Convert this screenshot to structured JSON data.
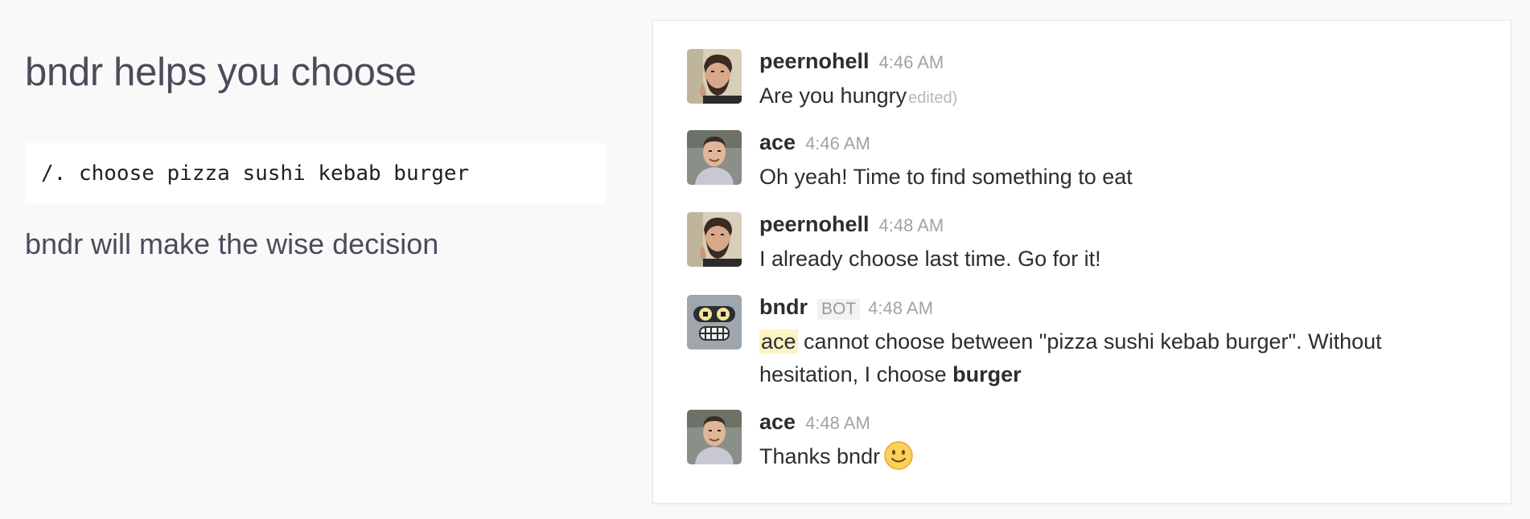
{
  "left": {
    "heading": "bndr helps you choose",
    "command": "/. choose pizza sushi kebab burger",
    "tagline": "bndr will make the wise decision"
  },
  "chat": {
    "messages": [
      {
        "author": "peernohell",
        "time": "4:46 AM",
        "text": "Are you  hungry",
        "edited": "edited)",
        "avatar": "user-avatar-bearded-man"
      },
      {
        "author": "ace",
        "time": "4:46 AM",
        "text": "Oh yeah! Time to find something to eat",
        "avatar": "user-avatar-smiling-man"
      },
      {
        "author": "peernohell",
        "time": "4:48 AM",
        "text": "I already choose last time. Go for it!",
        "avatar": "user-avatar-bearded-man"
      },
      {
        "author": "bndr",
        "bot_label": "BOT",
        "time": "4:48 AM",
        "mention": "ace",
        "text_before_bold": " cannot choose between \"pizza sushi kebab burger\". Without hesitation, I choose ",
        "bold": "burger",
        "avatar": "robot-bender-avatar"
      },
      {
        "author": "ace",
        "time": "4:48 AM",
        "text": "Thanks bndr",
        "emoji": "slightly-smiling-face",
        "avatar": "user-avatar-smiling-man"
      }
    ]
  },
  "colors": {
    "page_bg": "#f9f9fa",
    "heading": "#4a4c5a",
    "text": "#2c2d30",
    "muted": "#a3a3a7",
    "mention_bg": "#fdf3c4"
  }
}
